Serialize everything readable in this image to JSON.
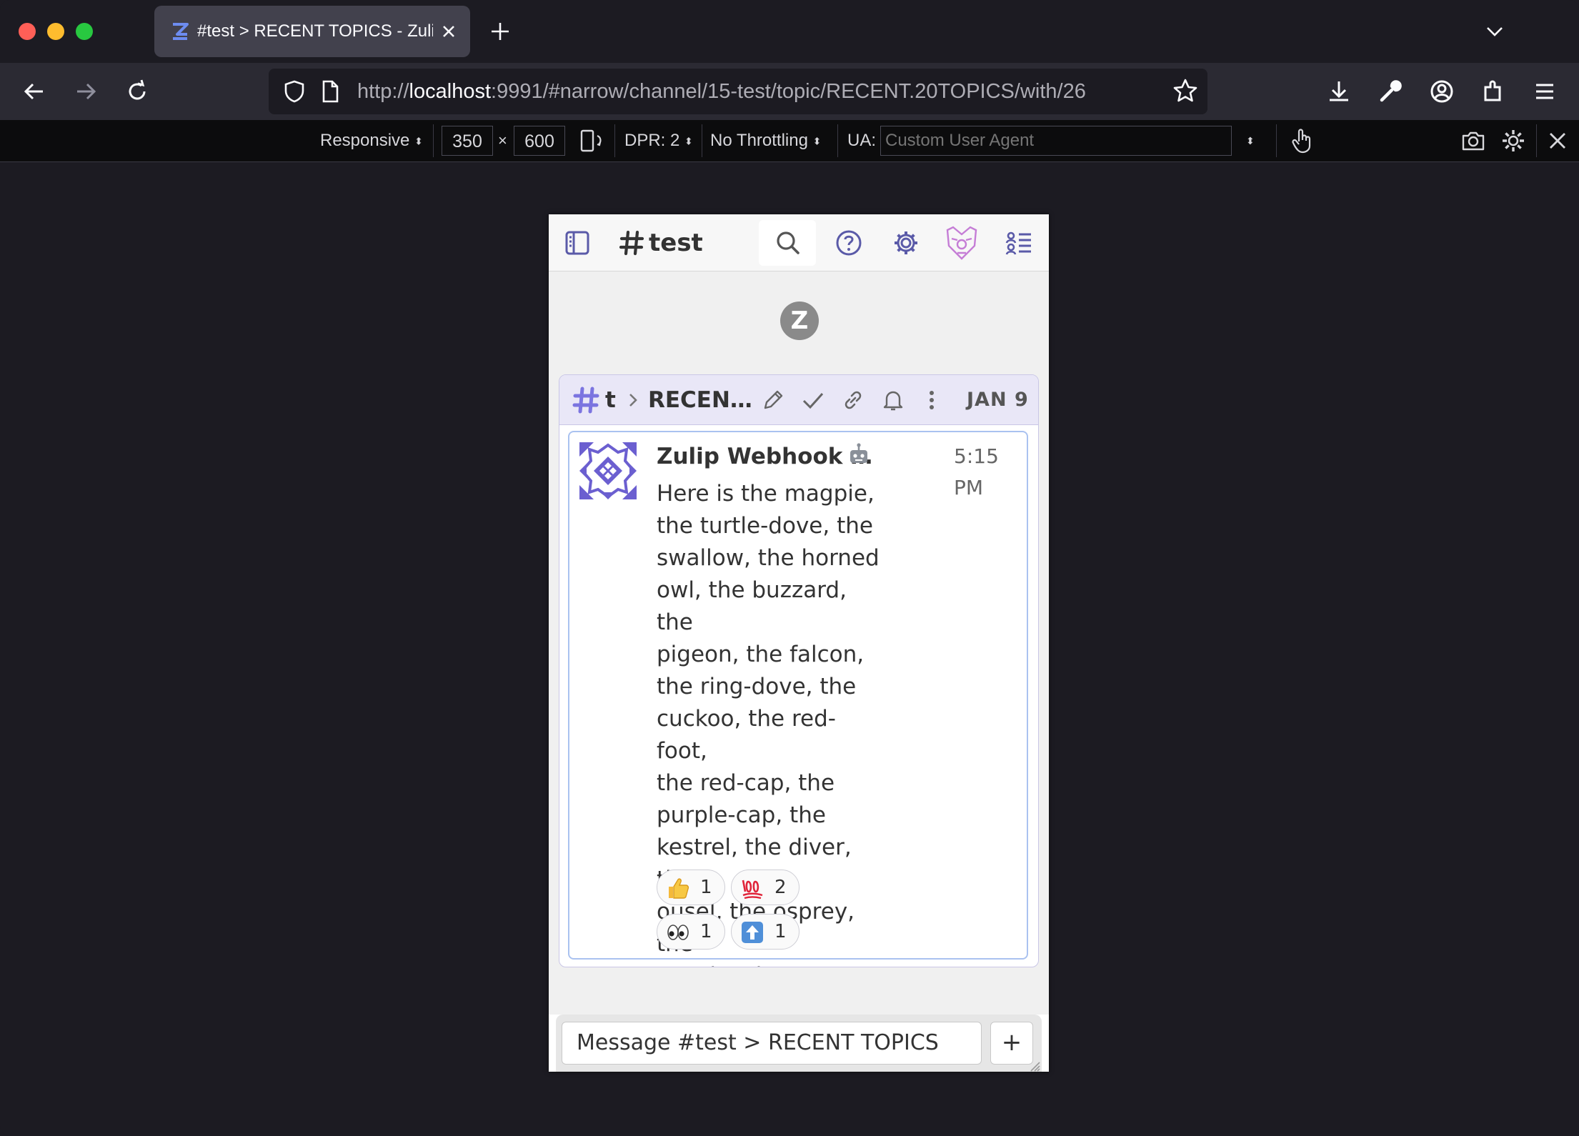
{
  "browser": {
    "tab": {
      "title": "#test > RECENT TOPICS - Zulip"
    },
    "url": {
      "scheme": "http://",
      "host": "localhost",
      "rest": ":9991/#narrow/channel/15-test/topic/RECENT.20TOPICS/with/26"
    }
  },
  "devtools": {
    "device_mode": "Responsive",
    "width": "350",
    "times": "×",
    "height": "600",
    "dpr": "DPR: 2",
    "throttling": "No Throttling",
    "ua_label": "UA:",
    "ua_placeholder": "Custom User Agent"
  },
  "zulip": {
    "header": {
      "channel_title": "test"
    },
    "recipient": {
      "channel": "test",
      "topic": "RECEN…",
      "date": "JAN 9"
    },
    "message": {
      "sender": "Zulip Webhook …",
      "time": "5:15 PM",
      "lines": [
        "Here is the magpie,",
        "the turtle-dove, the",
        "swallow, the horned",
        "owl, the buzzard, the",
        "pigeon, the falcon,",
        "the ring-dove, the",
        "cuckoo, the red-foot,",
        "the red-cap, the",
        "purple-cap, the",
        "kestrel, the diver, the",
        "ousel, the osprey, the",
        "woodpecker."
      ],
      "reactions": [
        {
          "emoji": "thumbs-up",
          "count": "1"
        },
        {
          "emoji": "hundred-points",
          "count": "2"
        },
        {
          "emoji": "eyes",
          "count": "1"
        },
        {
          "emoji": "up-arrow",
          "count": "1"
        }
      ]
    },
    "compose": {
      "placeholder": "Message #test > RECENT TOPICS",
      "plus": "+"
    }
  },
  "colors": {
    "brand": "#6f6fd6",
    "recipient_bar": "#e9e7f7",
    "message_border": "#aac2f0"
  }
}
